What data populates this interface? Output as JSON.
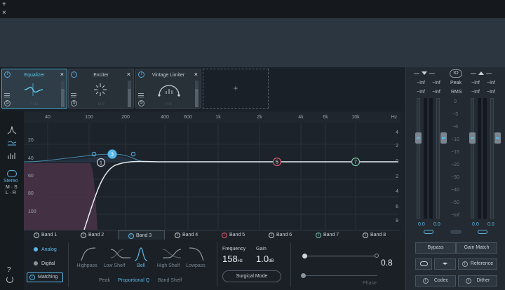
{
  "window": {
    "add_icon": "plus-icon",
    "close_icon": "close-icon"
  },
  "modules": [
    {
      "name": "Equalizer",
      "active": true
    },
    {
      "name": "Exciter",
      "active": false
    },
    {
      "name": "Vintage Limiter",
      "active": false
    }
  ],
  "add_module_label": "+",
  "freq_ticks": [
    "40",
    "100",
    "200",
    "400",
    "600",
    "1k",
    "2k",
    "4k",
    "6k",
    "10k",
    "Hz"
  ],
  "db_left": [
    "20",
    "40",
    "60",
    "80",
    "100"
  ],
  "db_right": [
    "4",
    "2",
    "0",
    "2",
    "4",
    "6",
    "8"
  ],
  "left_tools": {
    "stereo_label": "Stereo",
    "ms_label": "M · S",
    "lr_label": "L · R"
  },
  "band_nodes": [
    "1",
    "3",
    "5",
    "7"
  ],
  "bands": [
    {
      "label": "Band 1",
      "active": false,
      "color": "#c8d0d8"
    },
    {
      "label": "Band 2",
      "active": false,
      "color": "#c8d0d8"
    },
    {
      "label": "Band 3",
      "active": true,
      "color": "#5ab8e8"
    },
    {
      "label": "Band 4",
      "active": false,
      "color": "#c8d0d8"
    },
    {
      "label": "Band 5",
      "active": false,
      "color": "#e05a72"
    },
    {
      "label": "Band 6",
      "active": false,
      "color": "#c8d0d8"
    },
    {
      "label": "Band 7",
      "active": false,
      "color": "#7cc8a8"
    },
    {
      "label": "Band 8",
      "active": false,
      "color": "#c8d0d8"
    }
  ],
  "eq_mode": {
    "analog": "Analog",
    "digital": "Digital",
    "matching": "Matching",
    "selected": "Analog"
  },
  "filter_shapes": [
    "Highpass",
    "Low Shelf",
    "Bell",
    "High Shelf",
    "Lowpass"
  ],
  "selected_shape": "Bell",
  "curve_types": [
    "Peak",
    "Proportional Q",
    "Band Shelf"
  ],
  "selected_curve_type": "Proportional Q",
  "params": {
    "frequency_label": "Frequency",
    "frequency_value": "158",
    "frequency_unit": "Hz",
    "gain_label": "Gain",
    "gain_value": "1.0",
    "gain_unit": "dB",
    "q_value": "0.8",
    "phase_label": "Phase",
    "surgical_mode": "Surgical Mode"
  },
  "meters": {
    "io_label": "IO",
    "peak_label": "Peak",
    "rms_label": "RMS",
    "in_peak": [
      "−Inf",
      "−Inf"
    ],
    "in_rms": [
      "−Inf",
      "−Inf"
    ],
    "out_peak": [
      "−Inf",
      "−Inf"
    ],
    "out_rms": [
      "−Inf",
      "−Inf"
    ],
    "scale": [
      "0",
      "−3",
      "−6",
      "−10",
      "−15",
      "−20",
      "−30",
      "−40",
      "−50",
      "−Inf"
    ],
    "in_fader": [
      "0.0",
      "0.0"
    ],
    "out_fader": [
      "0.0",
      "0.0"
    ]
  },
  "right_buttons": {
    "bypass": "Bypass",
    "gain_match": "Gain Match",
    "reference": "Reference",
    "codec": "Codec",
    "dither": "Dither"
  },
  "colors": {
    "accent": "#5ab8e8",
    "band5": "#e05a72",
    "band7": "#7cc8a8",
    "highpass_fill": "#4a3448"
  }
}
